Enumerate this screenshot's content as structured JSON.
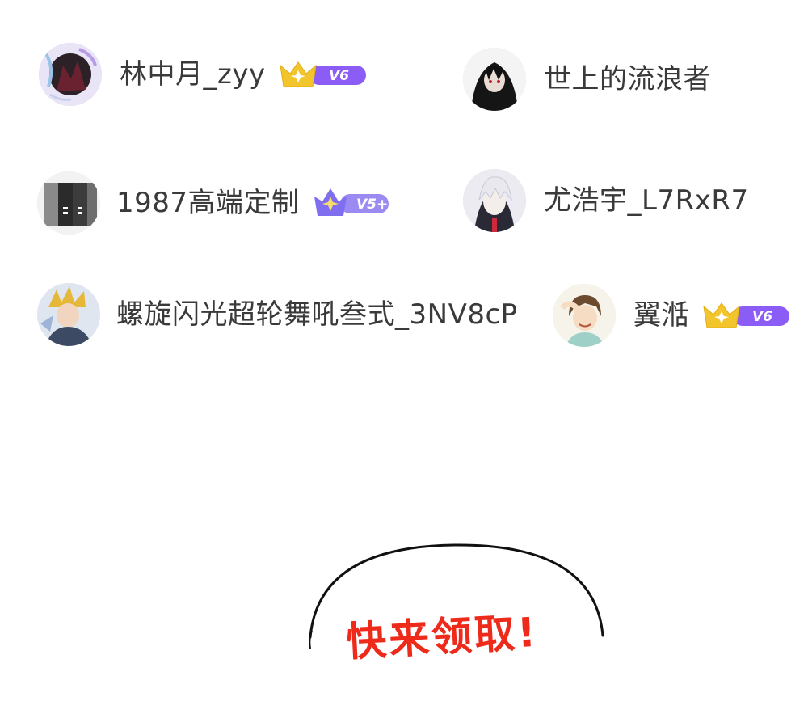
{
  "users": [
    {
      "name": "林中月_zyy",
      "badge": {
        "type": "crown",
        "level": "V6"
      }
    },
    {
      "name": "世上的流浪者",
      "badge": null
    },
    {
      "name": "1987高端定制",
      "badge": {
        "type": "diamond-crown",
        "level": "V5+"
      }
    },
    {
      "name": "尤浩宇_L7RxR7",
      "badge": null
    },
    {
      "name": "螺旋闪光超轮舞吼叁式_3NV8cP",
      "badge": null
    },
    {
      "name": "翼湉",
      "badge": {
        "type": "crown",
        "level": "V6"
      }
    }
  ],
  "call_to_action": {
    "text": "快来领取!"
  },
  "colors": {
    "name_text": "#3a3a3a",
    "crown_gold": "#f3c52d",
    "badge_purple": "#8b5cf6",
    "cta_red": "#ee2a1b"
  }
}
